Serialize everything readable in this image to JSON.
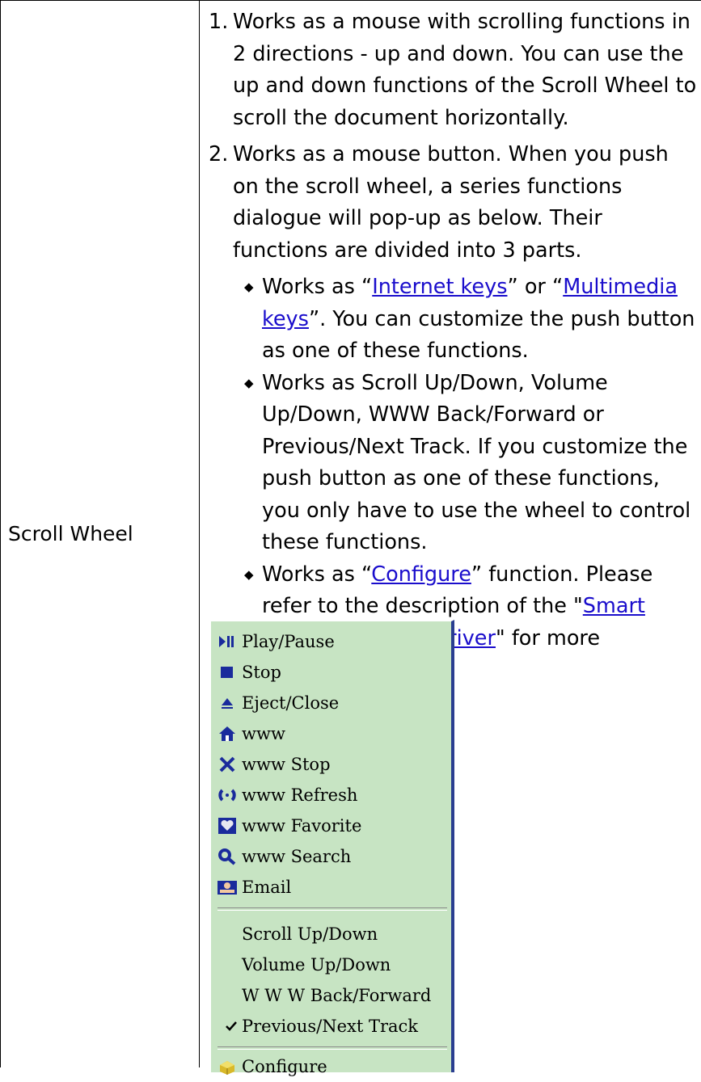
{
  "cell_label": "Scroll Wheel",
  "item1": {
    "num": "1.",
    "text": "Works as a mouse with scrolling functions in 2 directions - up and down. You can use the up and down functions of the Scroll Wheel to scroll the document horizontally."
  },
  "item2": {
    "num": "2.",
    "text": "Works as a mouse button. When you push on the scroll wheel, a series functions dialogue will pop-up as below. Their functions are divided into 3 parts."
  },
  "bullet1": {
    "pre": "Works as “",
    "link1": "Internet keys",
    "mid": "” or “",
    "link2": "Multimedia keys",
    "post": "”. You can customize the push button as one of these functions."
  },
  "bullet2": {
    "text": "Works as Scroll Up/Down, Volume Up/Down, WWW Back/Forward or Previous/Next Track. If you customize the push button as one of these functions, you only have to use the wheel to control these functions."
  },
  "bullet3": {
    "pre": "Works as “",
    "link1": "Configure",
    "mid": "” function. Please refer to the description of the \"",
    "link2": "Smart Office Keyboard Driver",
    "post": "\" for more information."
  },
  "menu": {
    "items": [
      {
        "label": "Play/Pause",
        "icon": "play-pause-icon"
      },
      {
        "label": "Stop",
        "icon": "stop-icon"
      },
      {
        "label": "Eject/Close",
        "icon": "eject-icon"
      },
      {
        "label": "www",
        "icon": "home-icon"
      },
      {
        "label": "www Stop",
        "icon": "close-x-icon"
      },
      {
        "label": "www Refresh",
        "icon": "refresh-icon"
      },
      {
        "label": "www Favorite",
        "icon": "favorite-heart-icon"
      },
      {
        "label": "www Search",
        "icon": "search-icon"
      },
      {
        "label": "Email",
        "icon": "email-icon"
      }
    ],
    "wheel_items": [
      {
        "label": "Scroll Up/Down",
        "checked": false
      },
      {
        "label": "Volume Up/Down",
        "checked": false
      },
      {
        "label": "W W W Back/Forward",
        "checked": false
      },
      {
        "label": "Previous/Next Track",
        "checked": true
      }
    ],
    "configure": {
      "label": "Configure",
      "icon": "configure-icon"
    }
  },
  "colors": {
    "menu_bg": "#c7e4c3",
    "menu_border": "#2a3e90",
    "link": "#1a0dcc",
    "icon_blue": "#1a2b9c"
  }
}
